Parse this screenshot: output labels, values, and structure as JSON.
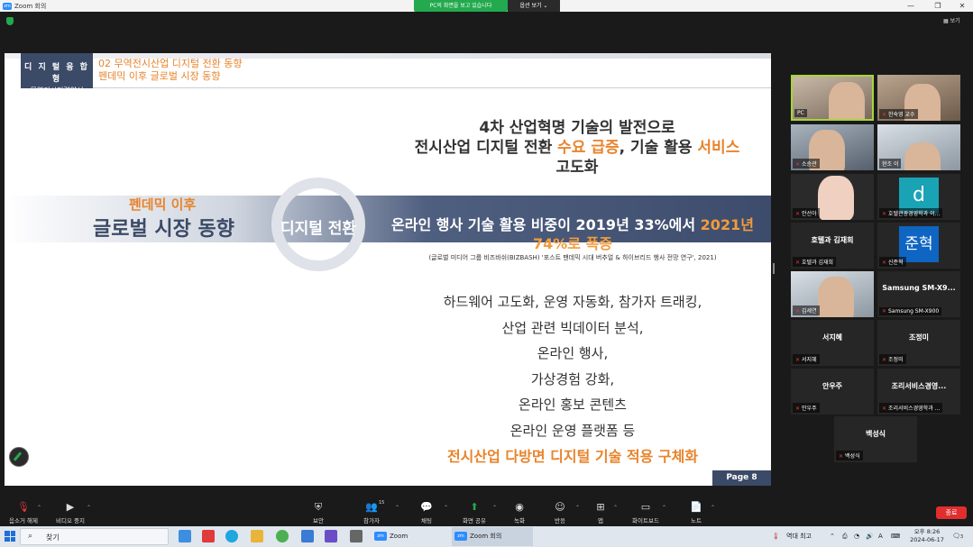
{
  "window": {
    "title": "Zoom 회의",
    "minimize": "—",
    "maximize": "❐",
    "close": "✕",
    "share_banner": "PC의 화면을 보고 있습니다",
    "view_options": "옵션 보기 ⌄",
    "view_button": "보기"
  },
  "slide": {
    "header_line1": "디 지 털 융 합 형",
    "header_line2": "무역전시인력양성",
    "section_title": "02 무역전시산업 디지털 전환 동향",
    "section_subtitle": "펜데믹 이후 글로벌 시장 동향",
    "headline_line1": "4차 산업혁명 기술의 발전으로",
    "headline_line2_a": "전시산업 디지털 전환 ",
    "headline_line2_b": "수요 급증",
    "headline_line2_c": ", 기술 활용 ",
    "headline_line2_d": "서비스",
    "headline_line3": "고도화",
    "band_sub": "펜데믹 이후",
    "band_main": "글로벌 시장 동향",
    "cycle_label": "디지털 전환",
    "band_right_a": "온라인 행사 기술 활용 비중이 2019년 33%에서 ",
    "band_right_b": "2021년",
    "band_right_c": "74%로 폭증",
    "citation": "(글로벌 미디어 그룹 비즈바쉬(BIZBASH) '포스트 팬데믹 시대 버추얼 & 하이브리드 행사 전망 연구', 2021)",
    "list": [
      "하드웨어 고도화, 운영 자동화, 참가자 트래킹,",
      "산업 관련 빅데이터 분석,",
      "온라인 행사,",
      "가상경험 강화,",
      "온라인 홍보 콘텐츠",
      "온라인 운영 플랫폼 등"
    ],
    "conclusion": "전시산업 다방면 디지털 기술 적용 구체화",
    "page_number": "Page 8"
  },
  "participants": [
    {
      "tag": "PC",
      "type": "video"
    },
    {
      "tag": "한숙영 교수",
      "type": "video2"
    },
    {
      "tag": "소승관",
      "type": "video3"
    },
    {
      "tag": "현조 이",
      "type": "video4"
    },
    {
      "tag": "안선아",
      "type": "avatar"
    },
    {
      "tag": "호텔관광경영학과 이...",
      "letter": "d",
      "type": "letter-teal"
    },
    {
      "name": "호텔과 김재희",
      "tag": "호텔과 김재희",
      "type": "name"
    },
    {
      "letter": "준혁",
      "tag": "신준혁",
      "type": "letter-blue"
    },
    {
      "tag": "김세연",
      "type": "video4"
    },
    {
      "name": "Samsung SM-X9...",
      "tag": "Samsung SM-X900",
      "type": "name"
    },
    {
      "name": "서지혜",
      "tag": "서지혜",
      "type": "name"
    },
    {
      "name": "조정미",
      "tag": "조정미",
      "type": "name"
    },
    {
      "name": "안우주",
      "tag": "안우주",
      "type": "name"
    },
    {
      "name": "조리서비스경영...",
      "tag": "조리서비스경영학과 ...",
      "type": "name"
    },
    {
      "name": "백성식",
      "tag": "백성식",
      "type": "name"
    }
  ],
  "toolbar": {
    "mute": "음소거 해제",
    "video": "비디오 중지",
    "security": "보안",
    "participants": "참가자",
    "participants_count": "15",
    "chat": "채팅",
    "share": "화면 공유",
    "record": "녹화",
    "reactions": "반응",
    "apps": "앱",
    "whiteboard": "화이트보드",
    "notes": "노트",
    "end": "종료"
  },
  "taskbar": {
    "search": "찾기",
    "zoom_app1": "Zoom",
    "zoom_app2": "Zoom 회의",
    "weather": "역대 최고",
    "ime": "A",
    "time": "오후 8:26",
    "date": "2024-06-17",
    "notifications": "3"
  }
}
